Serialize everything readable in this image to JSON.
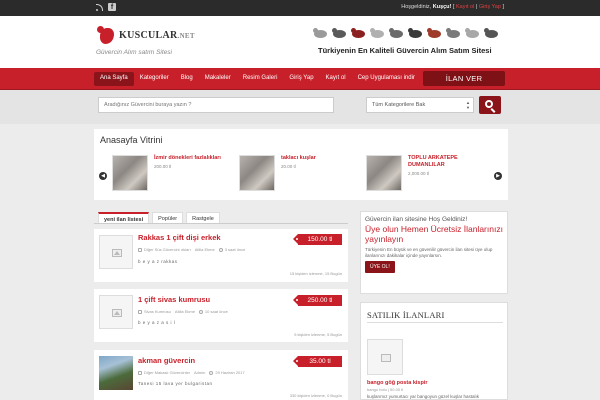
{
  "topbar": {
    "greeting": "Hoşgeldiniz,",
    "guest": "Kuşçu!",
    "open_bracket": "[",
    "register": "Kayıt ol",
    "separator": "|",
    "login": "Giriş Yap",
    "close_bracket": "]"
  },
  "header": {
    "logo_main": "KUSCULAR",
    "logo_ext": ".NET",
    "tagline": "Güvercin Alım satım Sitesi",
    "banner_text": "Türkiyenin En Kaliteli Güvercin Alım Satım Sitesi",
    "pigeon_colors": [
      "#9a9a9a",
      "#5a5a5a",
      "#8b2020",
      "#b0b0b0",
      "#6b6b6b",
      "#3a3a3a",
      "#9e3a2a",
      "#7a7a7a",
      "#a8a8a8",
      "#555555"
    ]
  },
  "nav": {
    "items": [
      "Ana Sayfa",
      "Kategoriler",
      "Blog",
      "Makaleler",
      "Resim Galeri",
      "Giriş Yap",
      "Kayıt ol",
      "Cep Uygulaması indir"
    ],
    "cta": "İLAN VER"
  },
  "search": {
    "placeholder": "Aradığınız Güvercini buraya yazın ?",
    "category": "Tüm Kategorilere Bak"
  },
  "vitrin": {
    "title": "Anasayfa Vitrini",
    "items": [
      {
        "name": "İzmir dönekleri fazlalıkları",
        "price": "200.00 tl"
      },
      {
        "name": "taklacı kuşlar",
        "price": "20.00 tl"
      },
      {
        "name": "TOPLU ARKATEPE DUMANLILAR",
        "price": "2,000.00 tl"
      }
    ]
  },
  "tabs": [
    "yeni ilan listesi",
    "Popüler",
    "Rastgele"
  ],
  "listings": [
    {
      "title": "Rakkas 1 çift dişi erkek",
      "price": "150.00 tl",
      "category": "Diğer Süs Güvercini ırkları",
      "author": "Atilla Ekme",
      "date": "3 saat önce",
      "desc": "b e y a z rakkas",
      "stats": "15 kişiden izlenme, 15 Bugün"
    },
    {
      "title": "1 çift sivas kumrusu",
      "price": "250.00 tl",
      "category": "Sivas Kumrusu",
      "author": "Atilla Ekme",
      "date": "10 saat önce",
      "desc": "b e y a z a s i l",
      "stats": "5 kişiden izlenme, 5 Bugün"
    },
    {
      "title": "akman güvercin",
      "price": "35.00 tl",
      "category": "Diğer Makaslı Güvercinler",
      "author": "Admin",
      "date": "29 Haziran 2017",
      "desc": "Tanesi 15 lava yer bulgaristan",
      "stats": "330 kişiden izlenme, 0 Bugün"
    }
  ],
  "sidebar": {
    "welcome_line1": "Güvercin ilan sitesine Hoş Geldiniz!",
    "welcome_line2": "Üye olun Hemen Ücretsiz İlanlarınızı yayınlayın",
    "welcome_line3": "Türkiyenin En büyük ve en güvenilir güvercin ilan sitesi üye olup ilanlarınızı dakikalar içinde yayınlarsın.",
    "signup": "ÜYE OL!",
    "satilik_title": "SATILIK İLANLARI",
    "satilik_item": {
      "name": "bango göğ posta kispir",
      "meta": "bango bolu | 50.00 tl",
      "desc": "kuşlarımız yumurtacı yar bangoyun güzel kuşlar hastalık"
    }
  }
}
